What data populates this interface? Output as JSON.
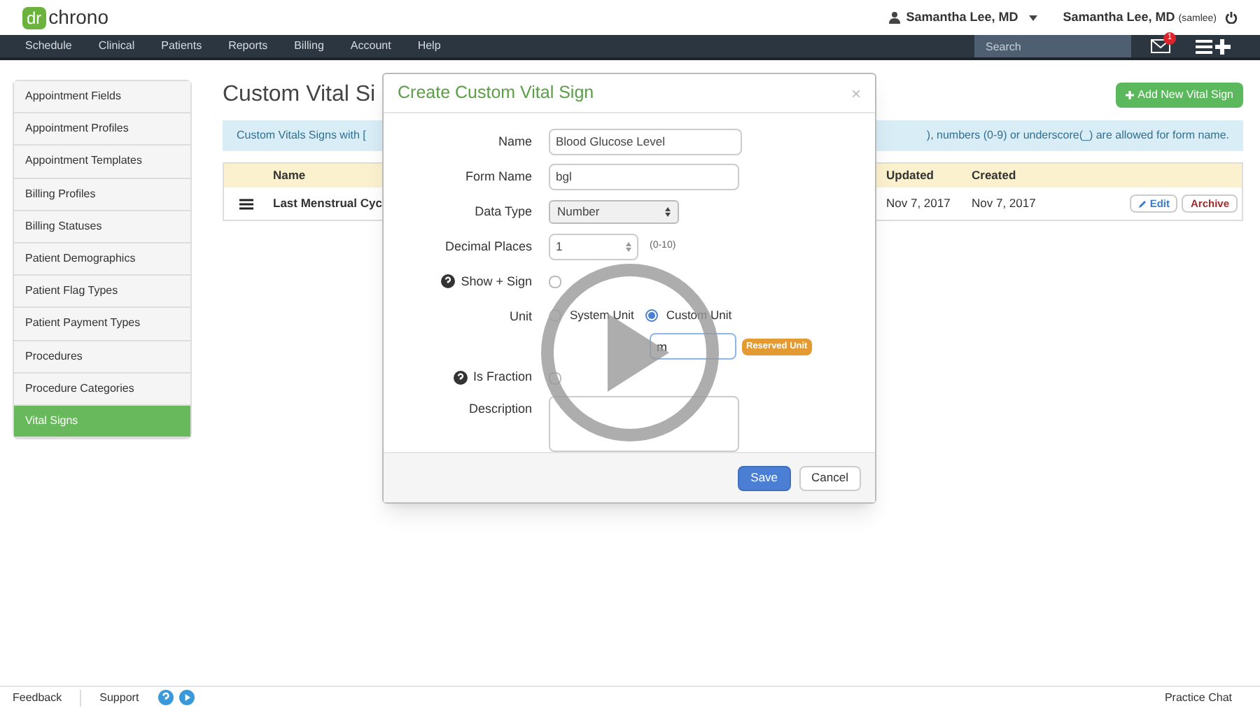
{
  "header": {
    "logo_mark": "dr",
    "logo_text": "chrono",
    "user_menu": "Samantha Lee, MD",
    "account_name": "Samantha Lee, MD",
    "account_handle": "(samlee)"
  },
  "nav": {
    "items": [
      "Schedule",
      "Clinical",
      "Patients",
      "Reports",
      "Billing",
      "Account",
      "Help"
    ],
    "search": {
      "placeholder": "Search"
    },
    "message_count": "1"
  },
  "sidebar": {
    "items": [
      {
        "label": "Appointment Fields",
        "selected": false
      },
      {
        "label": "Appointment Profiles",
        "selected": false
      },
      {
        "label": "Appointment Templates",
        "selected": false
      },
      {
        "label": "Billing Profiles",
        "selected": false
      },
      {
        "label": "Billing Statuses",
        "selected": false
      },
      {
        "label": "Patient Demographics",
        "selected": false
      },
      {
        "label": "Patient Flag Types",
        "selected": false
      },
      {
        "label": "Patient Payment Types",
        "selected": false
      },
      {
        "label": "Procedures",
        "selected": false
      },
      {
        "label": "Procedure Categories",
        "selected": false
      },
      {
        "label": "Vital Signs",
        "selected": true
      }
    ]
  },
  "page": {
    "title": "Custom Vital Si",
    "add_button": "Add New Vital Sign",
    "info_left": "Custom Vitals Signs with [",
    "info_right": "), numbers (0-9) or underscore(_) are allowed for form name.",
    "table": {
      "columns": [
        "Name",
        "Updated",
        "Created"
      ],
      "rows": [
        {
          "name": "Last Menstrual Cyc",
          "updated": "Nov 7, 2017",
          "created": "Nov 7, 2017",
          "actions": [
            "Edit",
            "Archive"
          ]
        }
      ]
    }
  },
  "modal": {
    "title": "Create Custom Vital Sign",
    "close": "×",
    "name": {
      "label": "Name",
      "value": "Blood Glucose Level"
    },
    "form_name": {
      "label": "Form Name",
      "value": "bgl"
    },
    "data_type": {
      "label": "Data Type",
      "value": "Number"
    },
    "decimal_places": {
      "label": "Decimal Places",
      "value": "1",
      "hint": "(0-10)"
    },
    "show_sign": {
      "label": "Show + Sign",
      "checked": false
    },
    "unit": {
      "label": "Unit",
      "options": [
        {
          "label": "System Unit",
          "selected": false
        },
        {
          "label": "Custom Unit",
          "selected": true
        }
      ],
      "value": "m",
      "badge": "Reserved Unit"
    },
    "is_fraction": {
      "label": "Is Fraction",
      "checked": false
    },
    "description": {
      "label": "Description"
    },
    "buttons": [
      "Save",
      "Cancel"
    ]
  },
  "footer": {
    "links": [
      "Feedback",
      "Support"
    ],
    "chat": "Practice Chat"
  }
}
